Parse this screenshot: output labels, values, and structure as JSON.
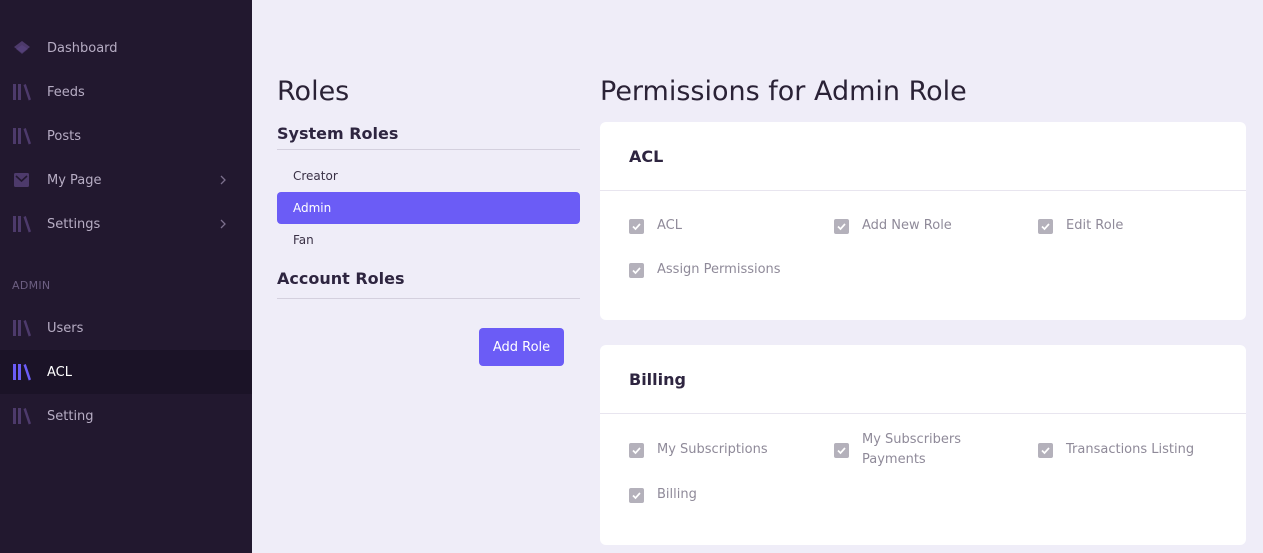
{
  "sidebar": {
    "items": [
      {
        "label": "Dashboard",
        "icon": "cube-icon"
      },
      {
        "label": "Feeds",
        "icon": "library-icon"
      },
      {
        "label": "Posts",
        "icon": "library-icon"
      },
      {
        "label": "My Page",
        "icon": "envelope-icon"
      },
      {
        "label": "Settings",
        "icon": "library-icon"
      }
    ],
    "admin_section_label": "ADMIN",
    "admin_items": [
      {
        "label": "Users",
        "icon": "library-icon"
      },
      {
        "label": "ACL",
        "icon": "library-icon",
        "active": true
      },
      {
        "label": "Setting",
        "icon": "library-icon"
      }
    ]
  },
  "roles": {
    "title": "Roles",
    "system_roles_title": "System Roles",
    "system_roles": [
      "Creator",
      "Admin",
      "Fan"
    ],
    "selected_role": "Admin",
    "account_roles_title": "Account Roles",
    "add_role_label": "Add Role"
  },
  "permissions": {
    "title": "Permissions for Admin Role",
    "groups": [
      {
        "name": "ACL",
        "items": [
          {
            "label": "ACL",
            "checked": true
          },
          {
            "label": "Add New Role",
            "checked": true
          },
          {
            "label": "Edit Role",
            "checked": true
          },
          {
            "label": "Assign Permissions",
            "checked": true
          }
        ]
      },
      {
        "name": "Billing",
        "items": [
          {
            "label": "My Subscriptions",
            "checked": true
          },
          {
            "label": "My Subscribers Payments",
            "checked": true
          },
          {
            "label": "Transactions Listing",
            "checked": true
          },
          {
            "label": "Billing",
            "checked": true
          }
        ]
      }
    ]
  },
  "colors": {
    "accent": "#6b5cf6",
    "sidebar_bg": "#22182f",
    "page_bg": "#efedf8",
    "icon_purple": "#4d3a6b"
  }
}
